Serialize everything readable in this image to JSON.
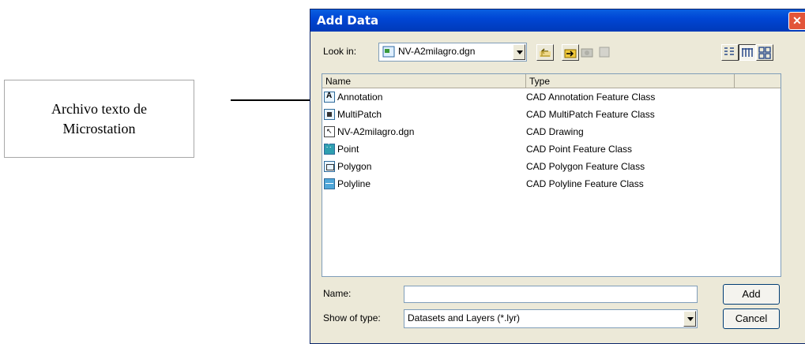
{
  "callout": {
    "line1": "Archivo texto de",
    "line2": "Microstation"
  },
  "dialog": {
    "title": "Add Data",
    "close_glyph": "✕",
    "look_in_label": "Look in:",
    "look_in_value": "NV-A2milagro.dgn",
    "toolbar_icons": [
      "up-one-level-icon",
      "connect-folder-icon",
      "disconnect-folder-icon",
      "new-item-icon",
      "list-view-icon",
      "details-view-icon",
      "thumbnails-view-icon"
    ],
    "columns": [
      "Name",
      "Type"
    ],
    "rows": [
      {
        "name": "Annotation",
        "type": "CAD Annotation Feature Class",
        "icon": "annotation-icon"
      },
      {
        "name": "MultiPatch",
        "type": "CAD MultiPatch Feature Class",
        "icon": "multipatch-icon"
      },
      {
        "name": "NV-A2milagro.dgn",
        "type": "CAD Drawing",
        "icon": "cad-drawing-icon"
      },
      {
        "name": "Point",
        "type": "CAD Point Feature Class",
        "icon": "point-icon"
      },
      {
        "name": "Polygon",
        "type": "CAD Polygon Feature Class",
        "icon": "polygon-icon"
      },
      {
        "name": "Polyline",
        "type": "CAD Polyline Feature Class",
        "icon": "polyline-icon"
      }
    ],
    "name_label": "Name:",
    "name_value": "",
    "show_type_label": "Show of type:",
    "show_type_value": "Datasets and Layers (*.lyr)",
    "add_button": "Add",
    "cancel_button": "Cancel"
  }
}
